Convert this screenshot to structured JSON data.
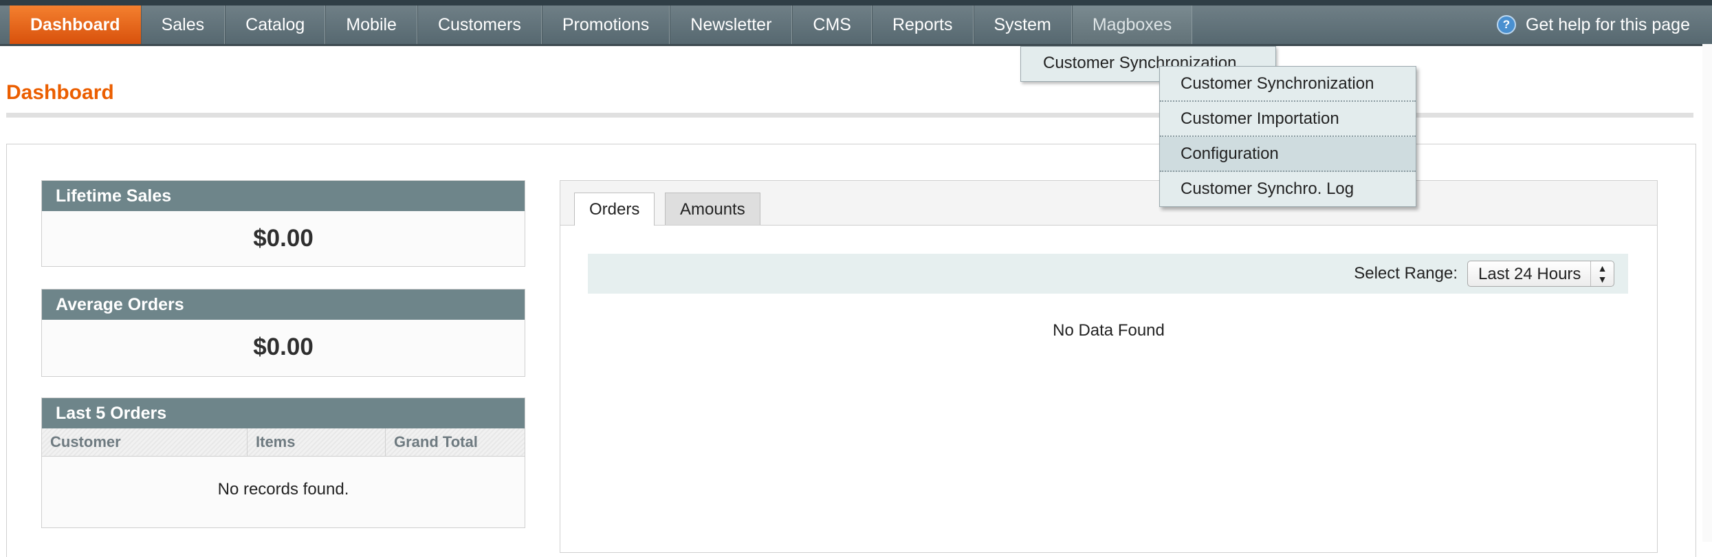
{
  "nav": {
    "items": [
      {
        "label": "Dashboard",
        "active": true
      },
      {
        "label": "Sales"
      },
      {
        "label": "Catalog"
      },
      {
        "label": "Mobile"
      },
      {
        "label": "Customers"
      },
      {
        "label": "Promotions"
      },
      {
        "label": "Newsletter"
      },
      {
        "label": "CMS"
      },
      {
        "label": "Reports"
      },
      {
        "label": "System"
      },
      {
        "label": "Magboxes"
      }
    ],
    "help_label": "Get help for this page",
    "help_icon": "?"
  },
  "magboxes_menu": {
    "item": "Customer Synchronization",
    "submenu": [
      "Customer Synchronization",
      "Customer Importation",
      "Configuration",
      "Customer Synchro. Log"
    ]
  },
  "page": {
    "title": "Dashboard"
  },
  "lifetime_sales": {
    "title": "Lifetime Sales",
    "value": "$0.00"
  },
  "average_orders": {
    "title": "Average Orders",
    "value": "$0.00"
  },
  "last_orders": {
    "title": "Last 5 Orders",
    "columns": [
      "Customer",
      "Items",
      "Grand Total"
    ],
    "empty_text": "No records found."
  },
  "chart_panel": {
    "tabs": [
      "Orders",
      "Amounts"
    ],
    "range_label": "Select Range:",
    "range_value": "Last 24 Hours",
    "range_arrows": "▲▼",
    "empty_text": "No Data Found"
  },
  "colors": {
    "accent": "#eb5e00",
    "nav_bg": "#5f6f76",
    "box_header": "#6e858a",
    "menu_bg": "#e3eced"
  }
}
